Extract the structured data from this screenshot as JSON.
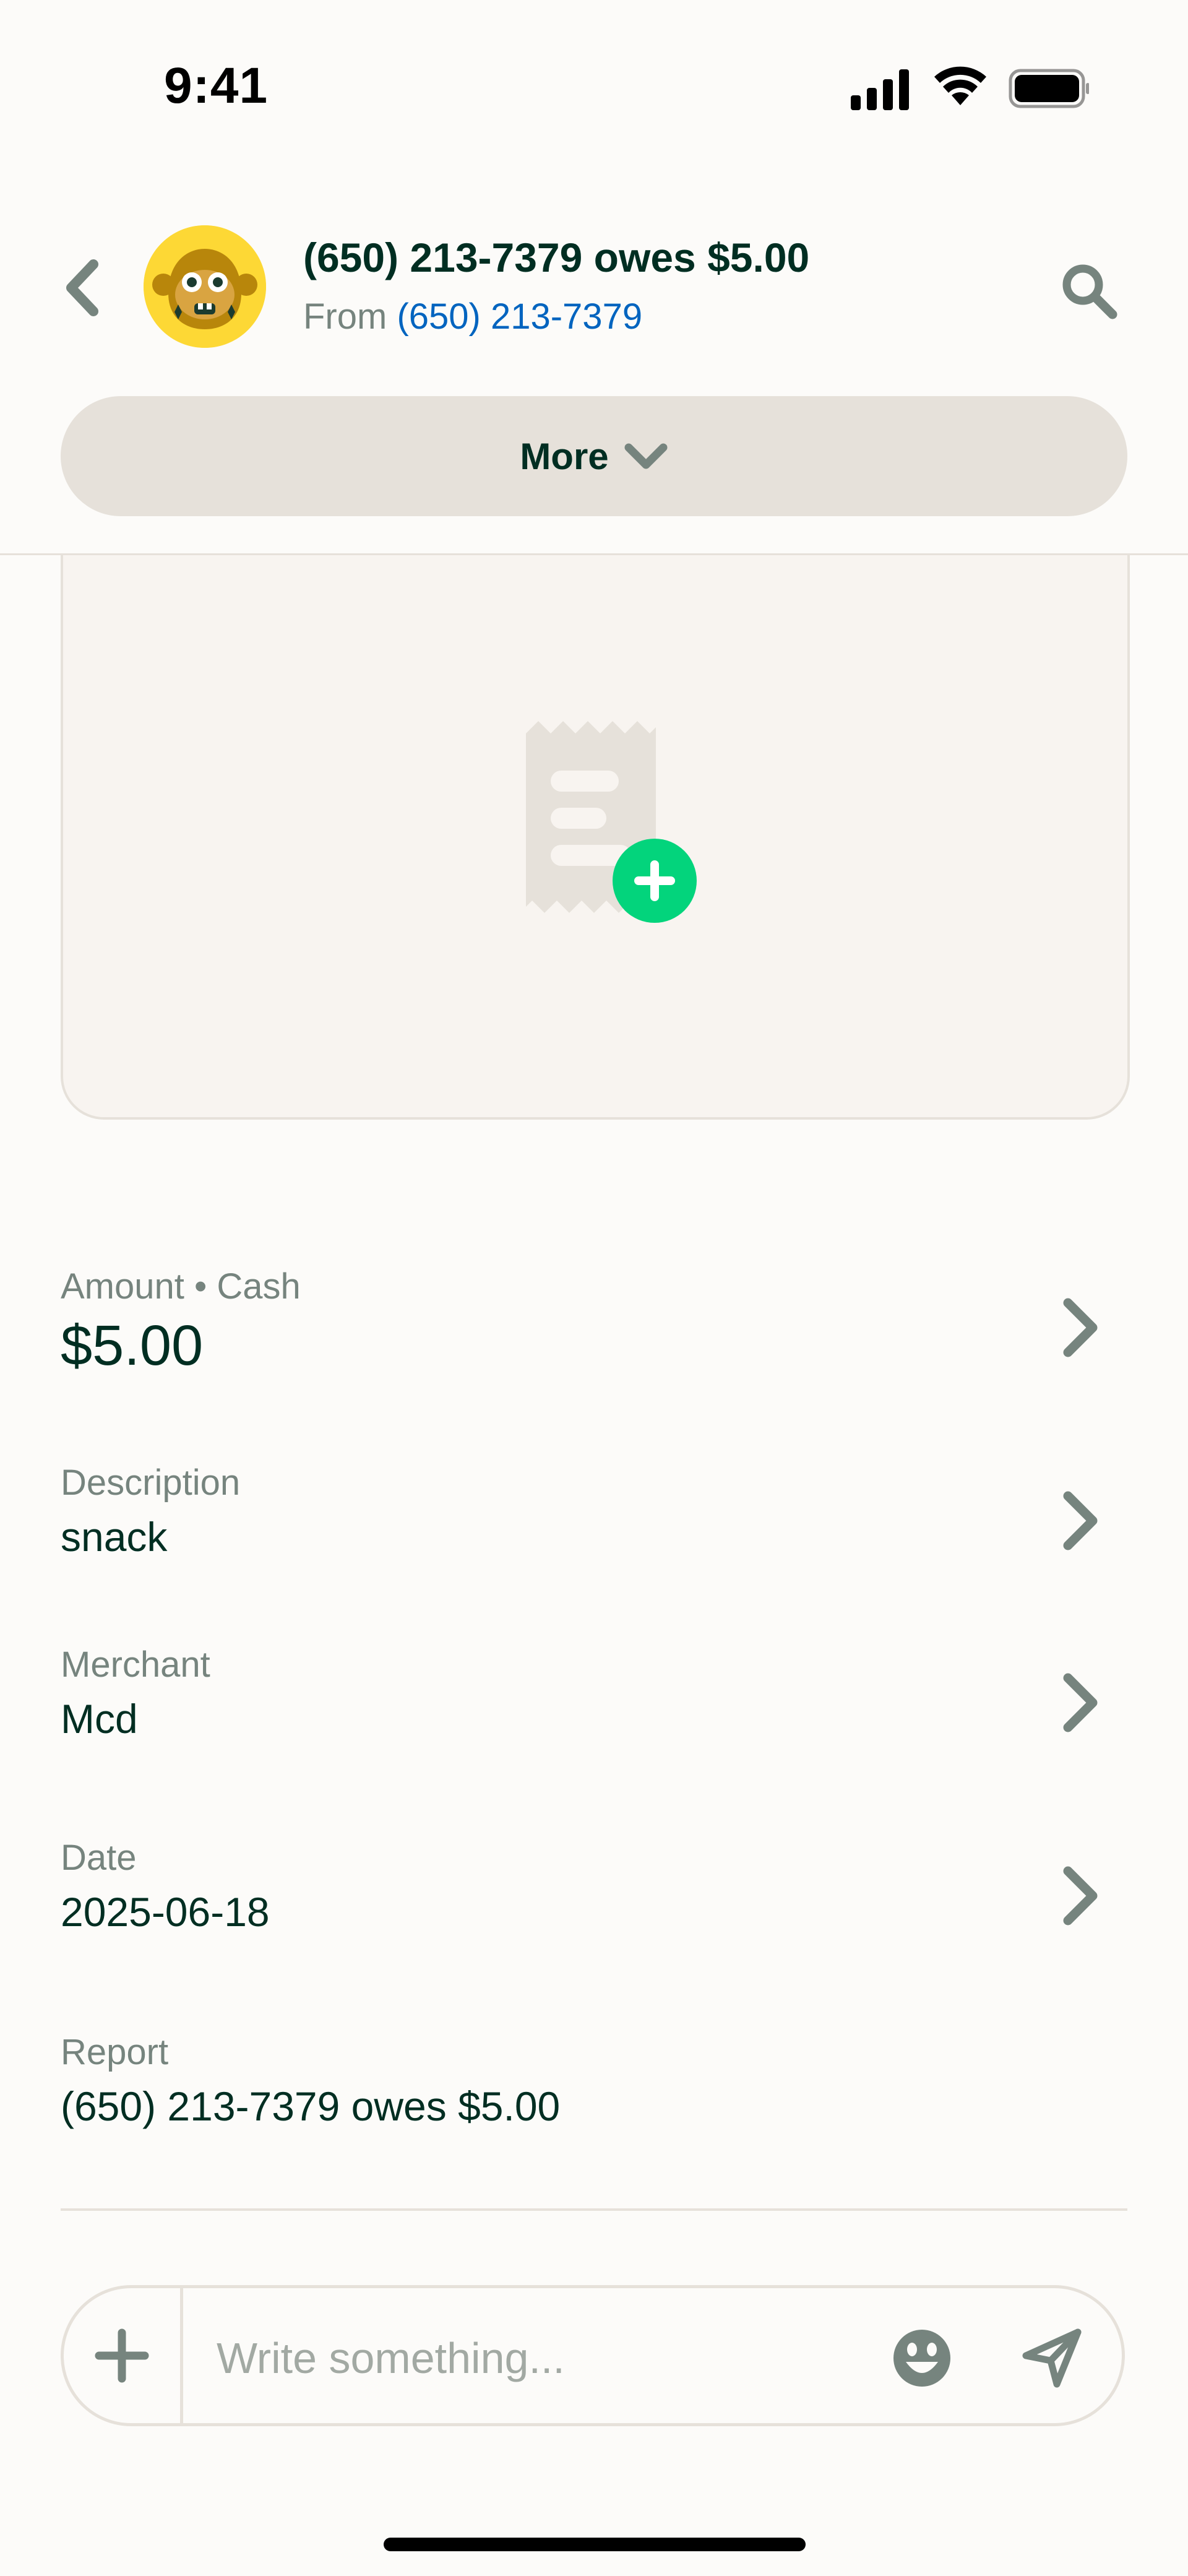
{
  "status_bar": {
    "time": "9:41"
  },
  "header": {
    "title": "(650) 213-7379 owes $5.00",
    "subtitle_prefix": "From",
    "subtitle_link": "(650) 213-7379",
    "more_label": "More",
    "avatar_icon": "monkey-avatar-icon"
  },
  "details": {
    "amount": {
      "label": "Amount • Cash",
      "value": "$5.00"
    },
    "description": {
      "label": "Description",
      "value": "snack"
    },
    "merchant": {
      "label": "Merchant",
      "value": "Mcd"
    },
    "date": {
      "label": "Date",
      "value": "2025-06-18"
    },
    "report": {
      "label": "Report",
      "value": "(650) 213-7379 owes $5.00"
    }
  },
  "composer": {
    "placeholder": "Write something..."
  },
  "colors": {
    "background": "#FCFBF9",
    "text_primary": "#002E22",
    "text_secondary": "#76847E",
    "link": "#0164BF",
    "accent_green": "#03D47C",
    "border": "#E6E1DA",
    "avatar_bg": "#FDD835"
  }
}
